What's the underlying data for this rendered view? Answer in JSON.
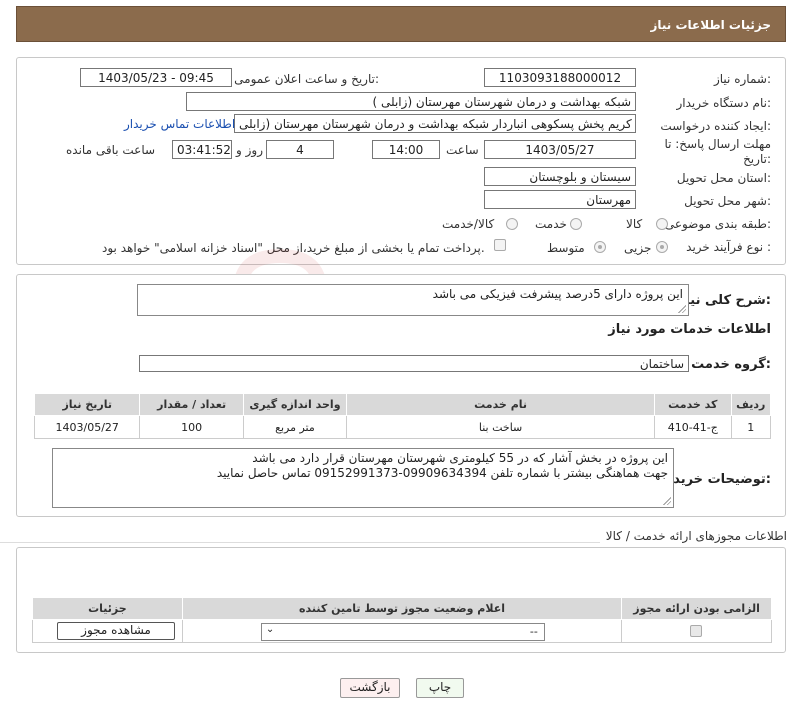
{
  "header": {
    "title": "جزئیات اطلاعات نیاز"
  },
  "form": {
    "need_number_label": "شماره نیاز:",
    "need_number": "1103093188000012",
    "announce_label": "تاریخ و ساعت اعلان عمومی:",
    "announce_value": "1403/05/23 - 09:45",
    "buyer_org_label": "نام دستگاه خریدار:",
    "buyer_org": "شبکه بهداشت و درمان شهرستان مهرستان (زابلی )",
    "creator_label": "ایجاد کننده درخواست:",
    "creator": "کریم پخش پسکوهی انباردار شبکه بهداشت و درمان شهرستان مهرستان (زابلی",
    "contact_link": "اطلاعات تماس خریدار",
    "deadline_label_1": "مهلت ارسال پاسخ: تا",
    "deadline_label_2": "تاریخ:",
    "deadline_date": "1403/05/27",
    "time_label": "ساعت",
    "deadline_time": "14:00",
    "days_value": "4",
    "days_label": "روز و",
    "remaining_time": "03:41:52",
    "remaining_label": "ساعت باقی مانده",
    "province_label": "استان محل تحویل:",
    "province": "سیستان و بلوچستان",
    "city_label": "شهر محل تحویل:",
    "city": "مهرستان",
    "category_label": "طبقه بندی موضوعی:",
    "category_options": [
      "کالا",
      "خدمت",
      "کالا/خدمت"
    ],
    "process_label": "نوع فرآیند خرید :",
    "process_options": [
      "جزیی",
      "متوسط"
    ],
    "payment_note": "پرداخت تمام یا بخشی از مبلغ خرید،از محل \"اسناد خزانه اسلامی\" خواهد بود."
  },
  "summary": {
    "label": "شرح کلی نیاز:",
    "text": "این پروژه دارای 5درصد پیشرفت فیزیکی می باشد",
    "services_title": "اطلاعات خدمات مورد نیاز",
    "group_label": "گروه خدمت:",
    "group_value": "ساختمان"
  },
  "services_table": {
    "headers": [
      "ردیف",
      "کد خدمت",
      "نام خدمت",
      "واحد اندازه گیری",
      "تعداد / مقدار",
      "تاریخ نیاز"
    ],
    "rows": [
      [
        "1",
        "ج-41-410",
        "ساخت بنا",
        "متر مربع",
        "100",
        "1403/05/27"
      ]
    ]
  },
  "buyer_notes": {
    "label": "توضیحات خریدار:",
    "line1": "این پروژه در بخش آشار که در 55 کیلومتری شهرستان مهرستان  قرار دارد می باشد",
    "line2": "جهت هماهنگی بیشتر با شماره تلفن 09909634394-09152991373 تماس حاصل نمایید"
  },
  "permits": {
    "title": "اطلاعات مجوزهای ارائه خدمت / کالا",
    "headers": [
      "الزامی بودن ارائه مجوز",
      "اعلام وضعیت مجوز توسط تامین کننده",
      "جزئیات"
    ],
    "select_value": "--",
    "view_button": "مشاهده مجوز"
  },
  "buttons": {
    "print": "چاپ",
    "back": "بازگشت"
  },
  "watermark": {
    "text": "AriaTender.neT"
  },
  "colors": {
    "header_bg": "#8b6b4c",
    "link": "#1a4fb0"
  }
}
